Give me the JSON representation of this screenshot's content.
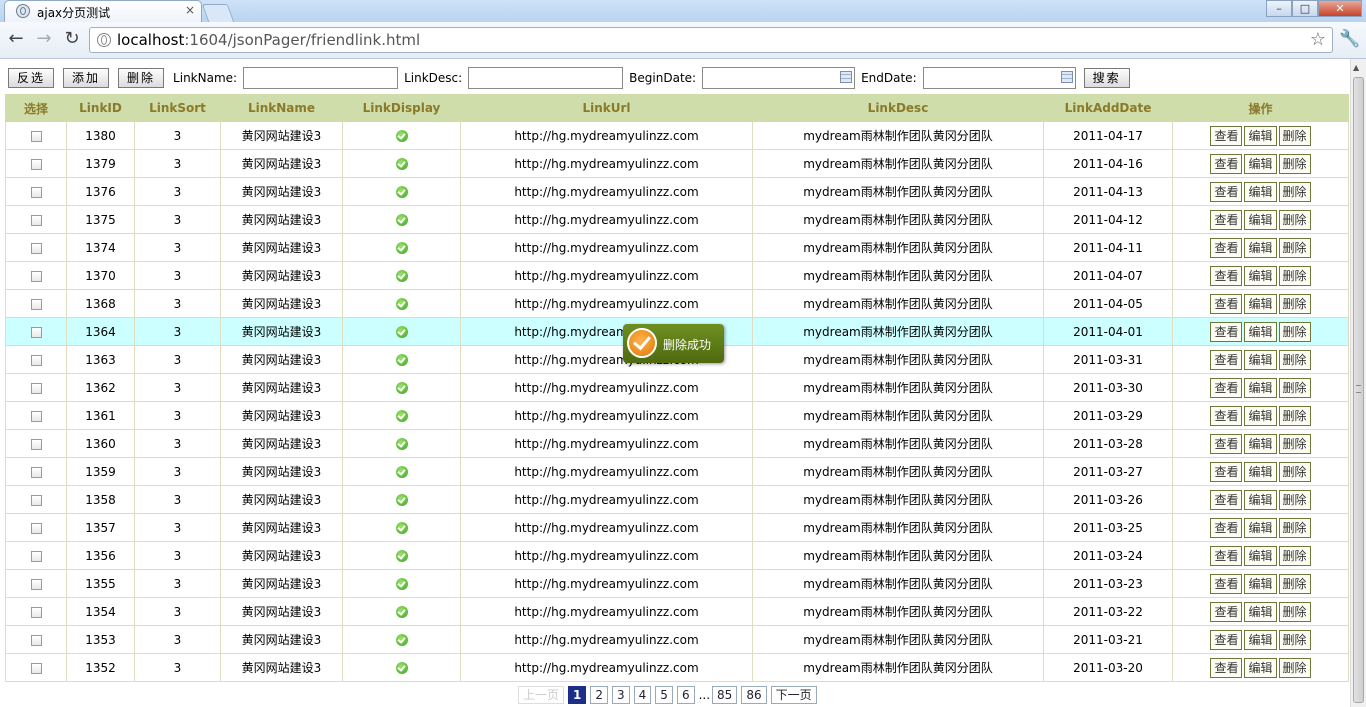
{
  "browser": {
    "tab_title": "ajax分页测试",
    "tab_close": "×",
    "url_host": "localhost",
    "url_rest": ":1604/jsonPager/friendlink.html",
    "win_min": "–",
    "win_max": "□",
    "win_close": "✕",
    "nav_back": "←",
    "nav_forward": "→",
    "nav_reload": "↻",
    "star": "☆",
    "wrench": "🔧"
  },
  "toolbar": {
    "invert_label": "反选",
    "add_label": "添加",
    "delete_label": "删除",
    "linkname_label": "LinkName:",
    "linkdesc_label": "LinkDesc:",
    "begindate_label": "BeginDate:",
    "enddate_label": "EndDate:",
    "search_label": "搜索",
    "linkname_value": "",
    "linkdesc_value": "",
    "begindate_value": "",
    "enddate_value": ""
  },
  "table": {
    "headers": [
      "选择",
      "LinkID",
      "LinkSort",
      "LinkName",
      "LinkDisplay",
      "LinkUrl",
      "LinkDesc",
      "LinkAddDate",
      "操作"
    ],
    "actions": {
      "view": "查看",
      "edit": "编辑",
      "delete": "删除"
    },
    "highlighted_row": 7,
    "rows": [
      {
        "id": "1380",
        "sort": "3",
        "name": "黄冈网站建设3",
        "display": true,
        "url": "http://hg.mydreamyulinzz.com",
        "desc": "mydream雨林制作团队黄冈分团队",
        "date": "2011-04-17"
      },
      {
        "id": "1379",
        "sort": "3",
        "name": "黄冈网站建设3",
        "display": true,
        "url": "http://hg.mydreamyulinzz.com",
        "desc": "mydream雨林制作团队黄冈分团队",
        "date": "2011-04-16"
      },
      {
        "id": "1376",
        "sort": "3",
        "name": "黄冈网站建设3",
        "display": true,
        "url": "http://hg.mydreamyulinzz.com",
        "desc": "mydream雨林制作团队黄冈分团队",
        "date": "2011-04-13"
      },
      {
        "id": "1375",
        "sort": "3",
        "name": "黄冈网站建设3",
        "display": true,
        "url": "http://hg.mydreamyulinzz.com",
        "desc": "mydream雨林制作团队黄冈分团队",
        "date": "2011-04-12"
      },
      {
        "id": "1374",
        "sort": "3",
        "name": "黄冈网站建设3",
        "display": true,
        "url": "http://hg.mydreamyulinzz.com",
        "desc": "mydream雨林制作团队黄冈分团队",
        "date": "2011-04-11"
      },
      {
        "id": "1370",
        "sort": "3",
        "name": "黄冈网站建设3",
        "display": true,
        "url": "http://hg.mydreamyulinzz.com",
        "desc": "mydream雨林制作团队黄冈分团队",
        "date": "2011-04-07"
      },
      {
        "id": "1368",
        "sort": "3",
        "name": "黄冈网站建设3",
        "display": true,
        "url": "http://hg.mydreamyulinzz.com",
        "desc": "mydream雨林制作团队黄冈分团队",
        "date": "2011-04-05"
      },
      {
        "id": "1364",
        "sort": "3",
        "name": "黄冈网站建设3",
        "display": true,
        "url": "http://hg.mydreamyulinzz.com",
        "desc": "mydream雨林制作团队黄冈分团队",
        "date": "2011-04-01"
      },
      {
        "id": "1363",
        "sort": "3",
        "name": "黄冈网站建设3",
        "display": true,
        "url": "http://hg.mydreamyulinzz.com",
        "desc": "mydream雨林制作团队黄冈分团队",
        "date": "2011-03-31"
      },
      {
        "id": "1362",
        "sort": "3",
        "name": "黄冈网站建设3",
        "display": true,
        "url": "http://hg.mydreamyulinzz.com",
        "desc": "mydream雨林制作团队黄冈分团队",
        "date": "2011-03-30"
      },
      {
        "id": "1361",
        "sort": "3",
        "name": "黄冈网站建设3",
        "display": true,
        "url": "http://hg.mydreamyulinzz.com",
        "desc": "mydream雨林制作团队黄冈分团队",
        "date": "2011-03-29"
      },
      {
        "id": "1360",
        "sort": "3",
        "name": "黄冈网站建设3",
        "display": true,
        "url": "http://hg.mydreamyulinzz.com",
        "desc": "mydream雨林制作团队黄冈分团队",
        "date": "2011-03-28"
      },
      {
        "id": "1359",
        "sort": "3",
        "name": "黄冈网站建设3",
        "display": true,
        "url": "http://hg.mydreamyulinzz.com",
        "desc": "mydream雨林制作团队黄冈分团队",
        "date": "2011-03-27"
      },
      {
        "id": "1358",
        "sort": "3",
        "name": "黄冈网站建设3",
        "display": true,
        "url": "http://hg.mydreamyulinzz.com",
        "desc": "mydream雨林制作团队黄冈分团队",
        "date": "2011-03-26"
      },
      {
        "id": "1357",
        "sort": "3",
        "name": "黄冈网站建设3",
        "display": true,
        "url": "http://hg.mydreamyulinzz.com",
        "desc": "mydream雨林制作团队黄冈分团队",
        "date": "2011-03-25"
      },
      {
        "id": "1356",
        "sort": "3",
        "name": "黄冈网站建设3",
        "display": true,
        "url": "http://hg.mydreamyulinzz.com",
        "desc": "mydream雨林制作团队黄冈分团队",
        "date": "2011-03-24"
      },
      {
        "id": "1355",
        "sort": "3",
        "name": "黄冈网站建设3",
        "display": true,
        "url": "http://hg.mydreamyulinzz.com",
        "desc": "mydream雨林制作团队黄冈分团队",
        "date": "2011-03-23"
      },
      {
        "id": "1354",
        "sort": "3",
        "name": "黄冈网站建设3",
        "display": true,
        "url": "http://hg.mydreamyulinzz.com",
        "desc": "mydream雨林制作团队黄冈分团队",
        "date": "2011-03-22"
      },
      {
        "id": "1353",
        "sort": "3",
        "name": "黄冈网站建设3",
        "display": true,
        "url": "http://hg.mydreamyulinzz.com",
        "desc": "mydream雨林制作团队黄冈分团队",
        "date": "2011-03-21"
      },
      {
        "id": "1352",
        "sort": "3",
        "name": "黄冈网站建设3",
        "display": true,
        "url": "http://hg.mydreamyulinzz.com",
        "desc": "mydream雨林制作团队黄冈分团队",
        "date": "2011-03-20"
      }
    ]
  },
  "pager": {
    "prev": "上一页",
    "pages": [
      "1",
      "2",
      "3",
      "4",
      "5",
      "6"
    ],
    "current": "1",
    "ellipsis": "...",
    "tail_pages": [
      "85",
      "86"
    ],
    "next": "下一页"
  },
  "toast": {
    "message": "删除成功"
  },
  "colors": {
    "header_bg": "#cfddaa",
    "header_text": "#8a7a2a",
    "highlight_row": "#ccffff",
    "toast_bg": "#5a7a15",
    "pager_current": "#1a2e8a"
  }
}
